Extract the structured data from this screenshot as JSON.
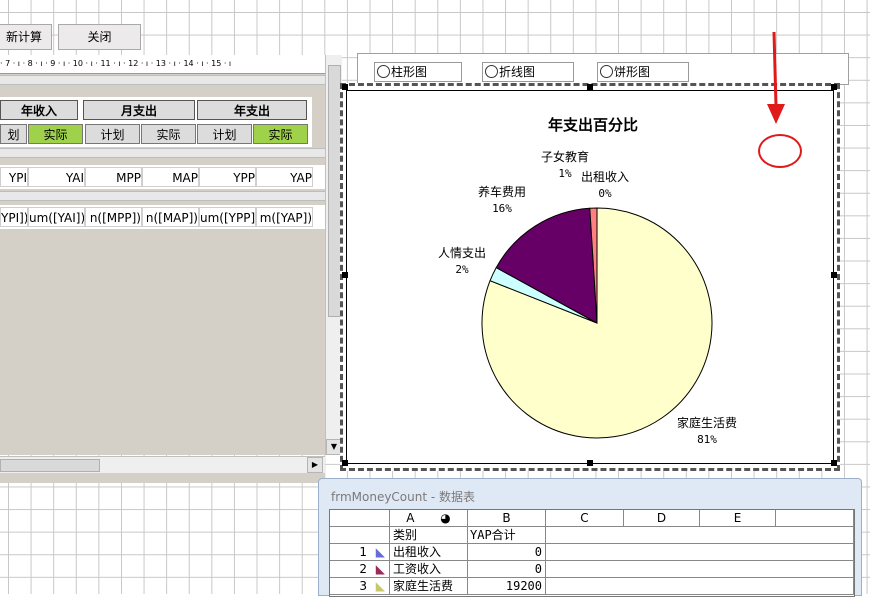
{
  "toolbar": {
    "recalc_label": "新计算",
    "close_label": "关闭"
  },
  "ruler": {
    "text": "· 7 · ı · 8 · ı · 9 · ı · 10 · ı · 11 · ı · 12 · ı · 13 · ı · 14 · ı · 15 · ı"
  },
  "form": {
    "header1": [
      "年收入",
      "月支出",
      "年支出"
    ],
    "header2": [
      "划",
      "实际",
      "计划",
      "实际",
      "计划",
      "实际"
    ],
    "row_fields": [
      "YPI",
      "YAI",
      "MPP",
      "MAP",
      "YPP",
      "YAP"
    ],
    "row_sums": [
      "YPI])",
      "um([YAI])",
      "n([MPP])",
      "n([MAP])",
      "um([YPP])",
      "m([YAP])"
    ]
  },
  "chart_type_options": [
    {
      "label": "柱形图"
    },
    {
      "label": "折线图"
    },
    {
      "label": "饼形图"
    }
  ],
  "chart_data": {
    "type": "pie",
    "title": "年支出百分比",
    "slices": [
      {
        "label": "家庭生活费",
        "percent": 81,
        "color": "#ffffcc"
      },
      {
        "label": "人情支出",
        "percent": 2,
        "color": "#ccffff"
      },
      {
        "label": "养车费用",
        "percent": 16,
        "color": "#660066"
      },
      {
        "label": "子女教育",
        "percent": 1,
        "color": "#ff8080"
      },
      {
        "label": "出租收入",
        "percent": 0,
        "color": "#9999ff"
      }
    ]
  },
  "datasheet": {
    "title": "frmMoneyCount - 数据表",
    "columns": [
      "A",
      "B",
      "C",
      "D",
      "E"
    ],
    "header_row": {
      "label": "类别",
      "value": "YAP合计"
    },
    "rows": [
      {
        "num": "1",
        "label": "出租收入",
        "value": "0"
      },
      {
        "num": "2",
        "label": "工资收入",
        "value": "0"
      },
      {
        "num": "3",
        "label": "家庭生活费",
        "value": "19200"
      }
    ]
  }
}
